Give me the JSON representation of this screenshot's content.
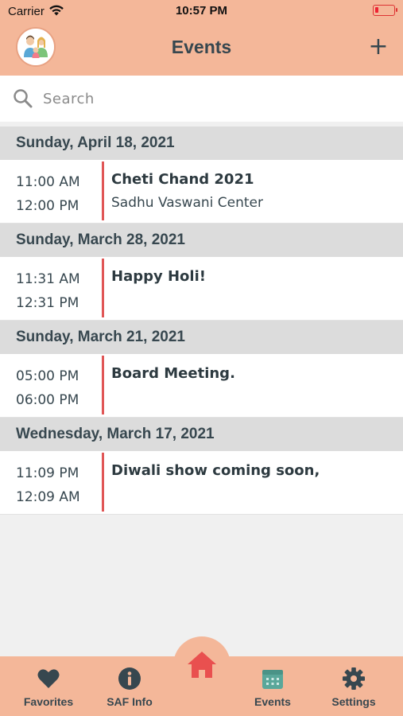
{
  "status_bar": {
    "carrier": "Carrier",
    "time": "10:57 PM"
  },
  "nav": {
    "title": "Events",
    "add_label": "+"
  },
  "search": {
    "placeholder": "Search",
    "value": ""
  },
  "sections": [
    {
      "date": "Sunday, April 18, 2021",
      "events": [
        {
          "start": "11:00 AM",
          "end": "12:00 PM",
          "title": "Cheti Chand 2021",
          "location": "Sadhu Vaswani Center"
        }
      ]
    },
    {
      "date": "Sunday, March 28, 2021",
      "events": [
        {
          "start": "11:31 AM",
          "end": "12:31 PM",
          "title": "Happy Holi!",
          "location": ""
        }
      ]
    },
    {
      "date": "Sunday, March 21, 2021",
      "events": [
        {
          "start": "05:00 PM",
          "end": "06:00 PM",
          "title": "Board Meeting.",
          "location": ""
        }
      ]
    },
    {
      "date": "Wednesday, March 17, 2021",
      "events": [
        {
          "start": "11:09 PM",
          "end": "12:09 AM",
          "title": "Diwali show coming soon,",
          "location": ""
        }
      ]
    }
  ],
  "tabs": [
    {
      "label": "Favorites",
      "icon": "heart-icon"
    },
    {
      "label": "SAF Info",
      "icon": "info-icon"
    },
    {
      "label": "",
      "icon": "home-icon"
    },
    {
      "label": "Events",
      "icon": "calendar-icon"
    },
    {
      "label": "Settings",
      "icon": "gear-icon"
    }
  ],
  "colors": {
    "header": "#f4b799",
    "accent_bar": "#e05656",
    "home_icon": "#e9504f",
    "events_icon": "#5aa79a"
  }
}
